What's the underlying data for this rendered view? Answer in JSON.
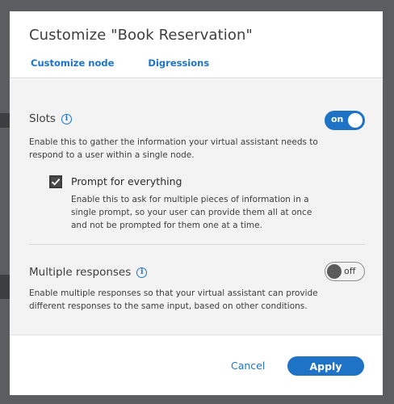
{
  "modal": {
    "title": "Customize \"Book Reservation\"",
    "tabs": [
      {
        "label": "Customize node",
        "active": true
      },
      {
        "label": "Digressions",
        "active": false
      }
    ]
  },
  "slots": {
    "title": "Slots",
    "info_icon": "info-icon",
    "toggle_state": "on",
    "toggle_label": "on",
    "description": "Enable this to gather the information your virtual assistant needs to respond to a user within a single node.",
    "prompt_checkbox": {
      "label": "Prompt for everything",
      "checked": true,
      "description": "Enable this to ask for multiple pieces of information in a single prompt, so your user can provide them all at once and not be prompted for them one at a time."
    }
  },
  "multiple_responses": {
    "title": "Multiple responses",
    "info_icon": "info-icon",
    "toggle_state": "off",
    "toggle_label": "off",
    "description": "Enable multiple responses so that your virtual assistant can provide different responses to the same input, based on other conditions."
  },
  "footer": {
    "cancel_label": "Cancel",
    "apply_label": "Apply"
  },
  "colors": {
    "accent": "#1e73c6",
    "backdrop": "#5b5d60",
    "body_bg": "#f3f3f3"
  }
}
